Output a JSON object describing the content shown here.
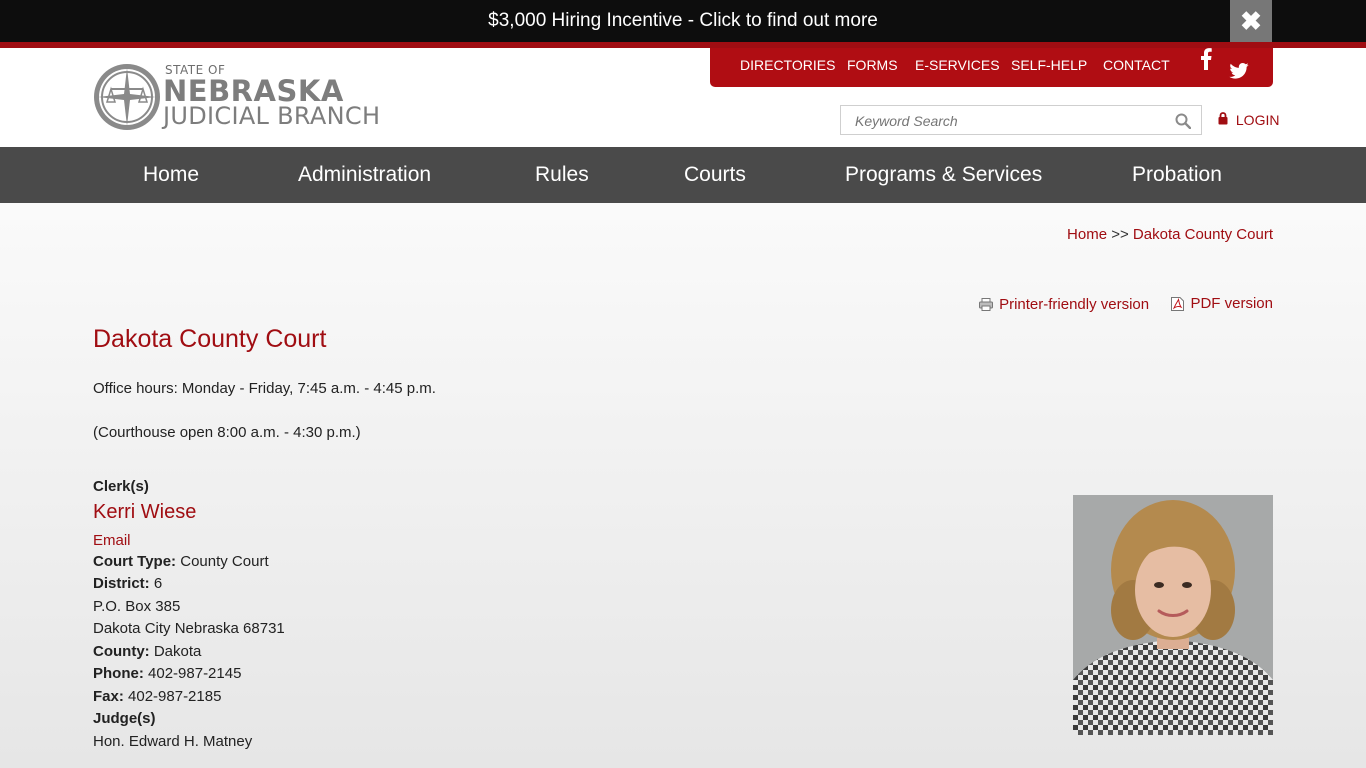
{
  "banner": {
    "text": "$3,000 Hiring Incentive - Click to find out more",
    "close_glyph": "✖"
  },
  "logo": {
    "line1": "STATE OF",
    "line2": "NEBRASKA",
    "line3": "JUDICIAL BRANCH"
  },
  "utility_nav": [
    "DIRECTORIES",
    "FORMS",
    "E-SERVICES",
    "SELF-HELP",
    "CONTACT"
  ],
  "social": [
    "facebook-icon",
    "twitter-icon"
  ],
  "search": {
    "placeholder": "Keyword Search"
  },
  "login": {
    "label": "LOGIN"
  },
  "main_nav": [
    "Home",
    "Administration",
    "Rules",
    "Courts",
    "Programs & Services",
    "Probation"
  ],
  "breadcrumb": {
    "home": "Home",
    "separator": ">>",
    "current": "Dakota County Court"
  },
  "print_links": {
    "printer": "Printer-friendly version",
    "pdf": "PDF version"
  },
  "page": {
    "title": "Dakota County Court",
    "office_hours": "Office hours:  Monday - Friday, 7:45 a.m. - 4:45 p.m.",
    "courthouse": "(Courthouse open 8:00 a.m. - 4:30 p.m.)"
  },
  "details": {
    "clerk_heading": "Clerk(s)",
    "clerk_name": "Kerri Wiese",
    "email_label": "Email",
    "court_type_label": "Court Type:",
    "court_type": "County Court",
    "district_label": "District:",
    "district": "6",
    "address1": "P.O. Box 385",
    "address2": "Dakota City Nebraska 68731",
    "county_label": "County:",
    "county": "Dakota",
    "phone_label": "Phone:",
    "phone": "402-987-2145",
    "fax_label": "Fax:",
    "fax": "402-987-2185",
    "judges_heading": "Judge(s)",
    "judge": "Hon. Edward H. Matney"
  },
  "colors": {
    "brand_red": "#a00d12",
    "nav_gray": "#4a4a4a",
    "banner_black": "#0d0d0d"
  }
}
